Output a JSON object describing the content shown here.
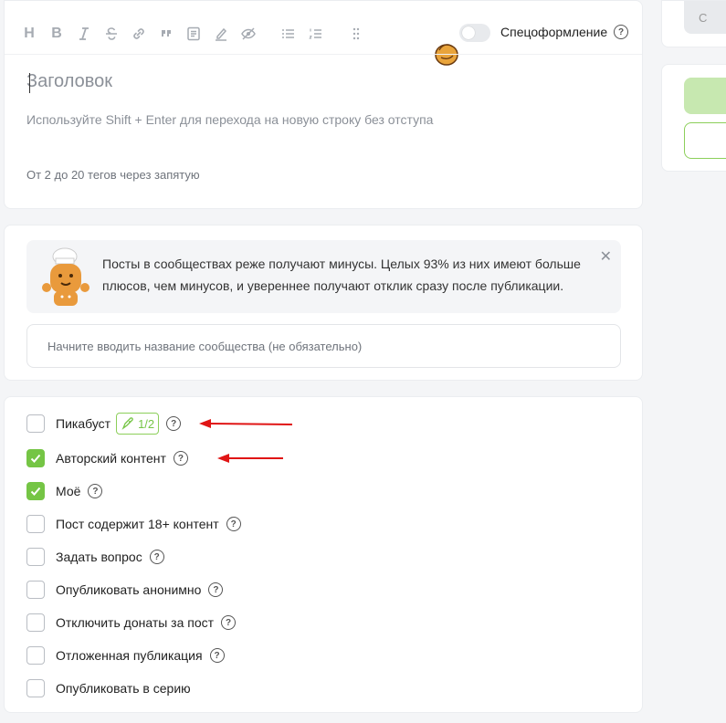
{
  "editor": {
    "toolbar": {
      "heading_icon": "heading-icon",
      "bold_icon": "bold-icon",
      "italic_icon": "italic-icon",
      "strikethrough_icon": "strikethrough-icon",
      "link_icon": "link-icon",
      "quote_icon": "quote-icon",
      "document_icon": "document-icon",
      "highlighter_icon": "highlighter-icon",
      "hidden_icon": "eye-off-icon",
      "bullet_list_icon": "bullet-list-icon",
      "numbered_list_icon": "numbered-list-icon",
      "drag_icon": "drag-handle-icon"
    },
    "spec_toggle": {
      "label": "Спецоформление",
      "on": false
    },
    "title_placeholder": "Заголовок",
    "body_placeholder": "Используйте Shift + Enter для перехода на новую строку без отступа",
    "tags_placeholder": "От 2 до 20 тегов через запятую"
  },
  "community": {
    "notice_text": "Посты в сообществах реже получают минусы. Целых 93% из них имеют больше плюсов, чем минусов, и увереннее получают отклик сразу после публикации.",
    "close_glyph": "✕",
    "input_placeholder": "Начните вводить название сообщества (не обязательно)"
  },
  "help_glyph": "?",
  "options": [
    {
      "label": "Пикабуст",
      "checked": false,
      "badge": "1/2"
    },
    {
      "label": "Авторский контент",
      "checked": true
    },
    {
      "label": "Моё",
      "checked": true
    },
    {
      "label": "Пост содержит 18+ контент",
      "checked": false
    },
    {
      "label": "Задать вопрос",
      "checked": false
    },
    {
      "label": "Опубликовать анонимно",
      "checked": false
    },
    {
      "label": "Отключить донаты за пост",
      "checked": false
    },
    {
      "label": "Отложенная публикация",
      "checked": false
    },
    {
      "label": "Опубликовать в серию",
      "checked": false
    }
  ],
  "right": {
    "gray_button_label": "С"
  },
  "colors": {
    "accent_green": "#75c545",
    "annotation_red": "#e01515"
  }
}
